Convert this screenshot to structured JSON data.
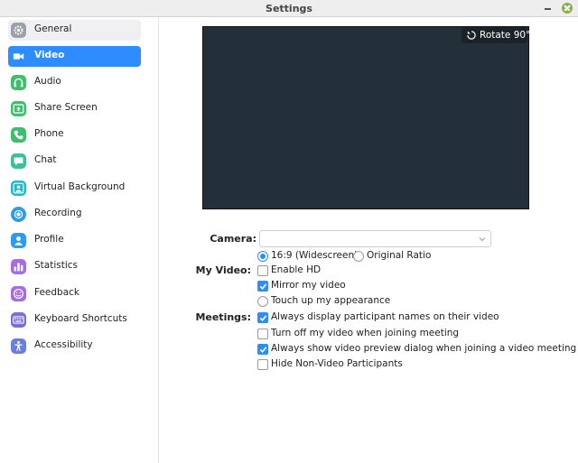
{
  "window": {
    "title": "Settings"
  },
  "sidebar": {
    "items": [
      {
        "label": "General"
      },
      {
        "label": "Video"
      },
      {
        "label": "Audio"
      },
      {
        "label": "Share Screen"
      },
      {
        "label": "Phone"
      },
      {
        "label": "Chat"
      },
      {
        "label": "Virtual Background"
      },
      {
        "label": "Recording"
      },
      {
        "label": "Profile"
      },
      {
        "label": "Statistics"
      },
      {
        "label": "Feedback"
      },
      {
        "label": "Keyboard Shortcuts"
      },
      {
        "label": "Accessibility"
      }
    ]
  },
  "video": {
    "rotate_label": "Rotate 90°",
    "camera_label": "Camera:",
    "camera_value": "",
    "my_video_label": "My Video:",
    "meetings_label": "Meetings:",
    "ratio": {
      "widescreen": "16:9 (Widescreen)",
      "original": "Original Ratio"
    },
    "options": {
      "enable_hd": "Enable HD",
      "mirror": "Mirror my video",
      "touch_up": "Touch up my appearance",
      "show_names": "Always display participant names on their video",
      "turn_off": "Turn off my video when joining meeting",
      "show_preview": "Always show video preview dialog when joining a video meeting",
      "hide_non_video": "Hide Non-Video Participants"
    }
  }
}
